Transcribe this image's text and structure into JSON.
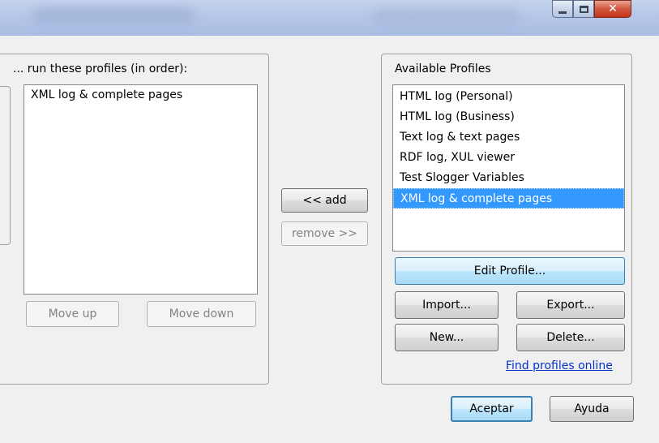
{
  "window": {
    "minimize_icon": "minimize-icon",
    "maximize_icon": "maximize-icon",
    "close_icon": "close-icon"
  },
  "left_panel": {
    "title": "... run these profiles (in order):",
    "items": [
      "XML log & complete pages"
    ],
    "move_up_label": "Move up",
    "move_down_label": "Move down"
  },
  "middle": {
    "add_label": "<< add",
    "remove_label": "remove >>"
  },
  "right_panel": {
    "title": "Available Profiles",
    "items": [
      "HTML log (Personal)",
      "HTML log (Business)",
      "Text log & text pages",
      "RDF log, XUL viewer",
      "Test Slogger Variables",
      "XML log & complete pages"
    ],
    "selected_index": 5,
    "edit_label": "Edit Profile...",
    "import_label": "Import...",
    "export_label": "Export...",
    "new_label": "New...",
    "delete_label": "Delete...",
    "find_link": "Find profiles online"
  },
  "footer": {
    "accept_label": "Aceptar",
    "help_label": "Ayuda"
  },
  "colors": {
    "selection": "#3399ff",
    "link": "#0033cc"
  }
}
